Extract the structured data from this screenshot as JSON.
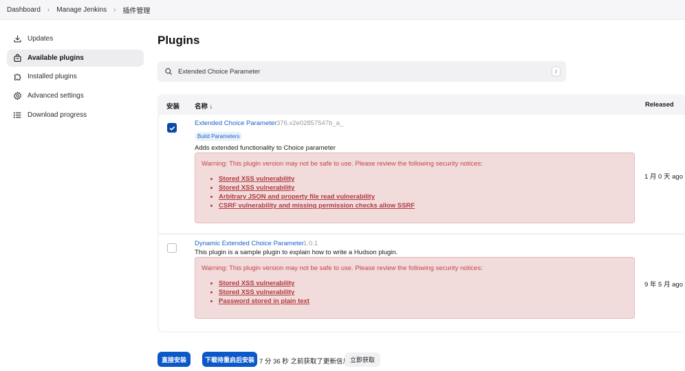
{
  "breadcrumb": {
    "items": [
      "Dashboard",
      "Manage Jenkins",
      "插件管理"
    ],
    "separator": "›"
  },
  "sidebar": {
    "items": [
      {
        "label": "Updates",
        "icon": "download-icon",
        "active": false
      },
      {
        "label": "Available plugins",
        "icon": "shopping-bag-icon",
        "active": true
      },
      {
        "label": "Installed plugins",
        "icon": "puzzle-icon",
        "active": false
      },
      {
        "label": "Advanced settings",
        "icon": "gear-icon",
        "active": false
      },
      {
        "label": "Download progress",
        "icon": "list-icon",
        "active": false
      }
    ]
  },
  "page": {
    "title": "Plugins"
  },
  "search": {
    "value": "Extended Choice Parameter",
    "shortcut": "/"
  },
  "table": {
    "headers": {
      "install": "安装",
      "name": "名称 ↓",
      "released": "Released"
    },
    "rows": [
      {
        "checked": true,
        "name": "Extended Choice Parameter",
        "version": "376.v2e02857547b_a_",
        "tag": "Build Parameters",
        "description": "Adds extended functionality to Choice parameter",
        "warning_title": "Warning: This plugin version may not be safe to use. Please review the following security notices:",
        "warnings": [
          "Stored XSS vulnerability",
          "Stored XSS vulnerability",
          "Arbitrary JSON and property file read vulnerability",
          "CSRF vulnerability and missing permission checks allow SSRF"
        ],
        "released": "1 月 0 天 ago"
      },
      {
        "checked": false,
        "name": "Dynamic Extended Choice Parameter",
        "version": "1.0.1",
        "description": "This plugin is a sample plugin to explain how to write a Hudson plugin.",
        "warning_title": "Warning: This plugin version may not be safe to use. Please review the following security notices:",
        "warnings": [
          "Stored XSS vulnerability",
          "Stored XSS vulnerability",
          "Password stored in plain text"
        ],
        "released": "9 年 5 月 ago"
      }
    ]
  },
  "footer": {
    "install_now": "直接安装",
    "install_after_restart": "下载待重启后安装",
    "status": "7 分 36 秒 之前获取了更新信息",
    "fetch_now": "立即获取"
  },
  "colors": {
    "accent": "#0b58c9",
    "link": "#1b62c9",
    "warning_bg": "#f2dbdb",
    "warning_text": "#c1444a"
  }
}
